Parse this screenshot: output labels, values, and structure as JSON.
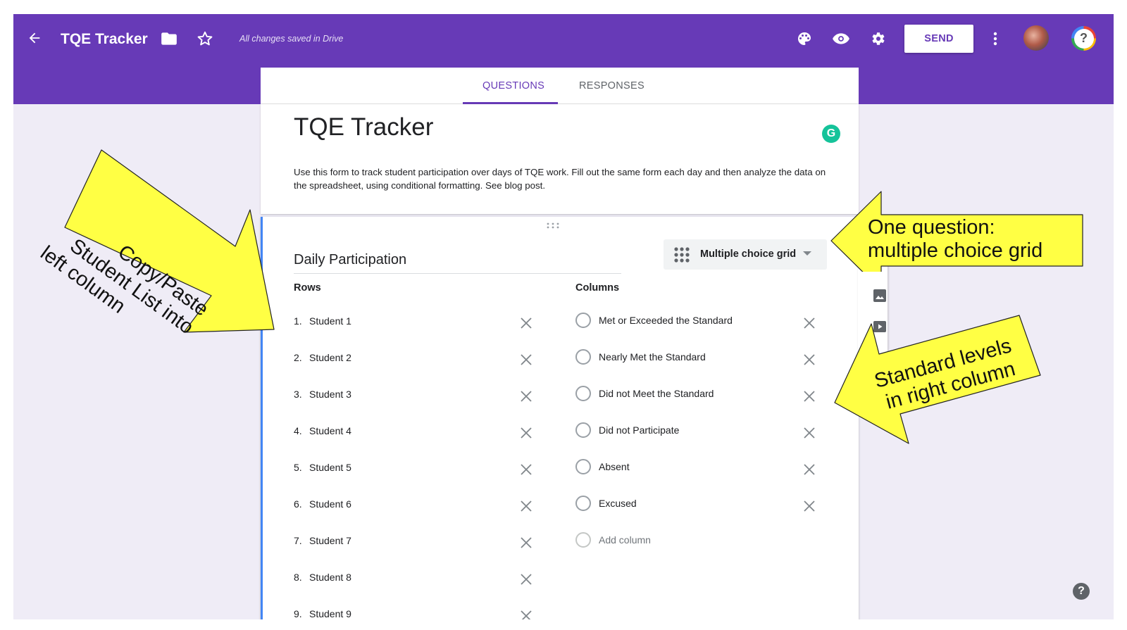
{
  "app": {
    "title": "TQE Tracker",
    "save_status": "All changes saved in Drive",
    "send_label": "SEND",
    "account_glyph": "?"
  },
  "tabs": [
    {
      "label": "QUESTIONS",
      "active": true
    },
    {
      "label": "RESPONSES",
      "active": false
    }
  ],
  "form": {
    "title": "TQE Tracker",
    "description": "Use this form to track student participation over days of TQE work. Fill out the same form each day and then analyze the data on the spreadsheet, using conditional formatting. See blog post.",
    "grammarly_glyph": "G"
  },
  "question": {
    "title": "Daily Participation",
    "type_label": "Multiple choice grid",
    "rows_label": "Rows",
    "columns_label": "Columns",
    "rows": [
      {
        "num": "1.",
        "label": "Student 1"
      },
      {
        "num": "2.",
        "label": "Student 2"
      },
      {
        "num": "3.",
        "label": "Student 3"
      },
      {
        "num": "4.",
        "label": "Student 4"
      },
      {
        "num": "5.",
        "label": "Student 5"
      },
      {
        "num": "6.",
        "label": "Student 6"
      },
      {
        "num": "7.",
        "label": "Student 7"
      },
      {
        "num": "8.",
        "label": "Student 8"
      },
      {
        "num": "9.",
        "label": "Student 9"
      }
    ],
    "columns": [
      {
        "label": "Met or Exceeded the Standard"
      },
      {
        "label": "Nearly Met the Standard"
      },
      {
        "label": "Did not Meet the Standard"
      },
      {
        "label": "Did not Participate"
      },
      {
        "label": "Absent"
      },
      {
        "label": "Excused"
      }
    ],
    "add_column_label": "Add column"
  },
  "help_glyph": "?",
  "annotations": {
    "left_line1": "Copy/Paste",
    "left_line2": "Student List into",
    "left_line3": "left column",
    "right_top_line1": "One question:",
    "right_top_line2": "multiple choice grid",
    "right_bottom_line1": "Standard levels",
    "right_bottom_line2": "in right column"
  },
  "colors": {
    "brand": "#673ab7",
    "callout_fill": "#ffff44",
    "active_bar": "#4285f4"
  }
}
